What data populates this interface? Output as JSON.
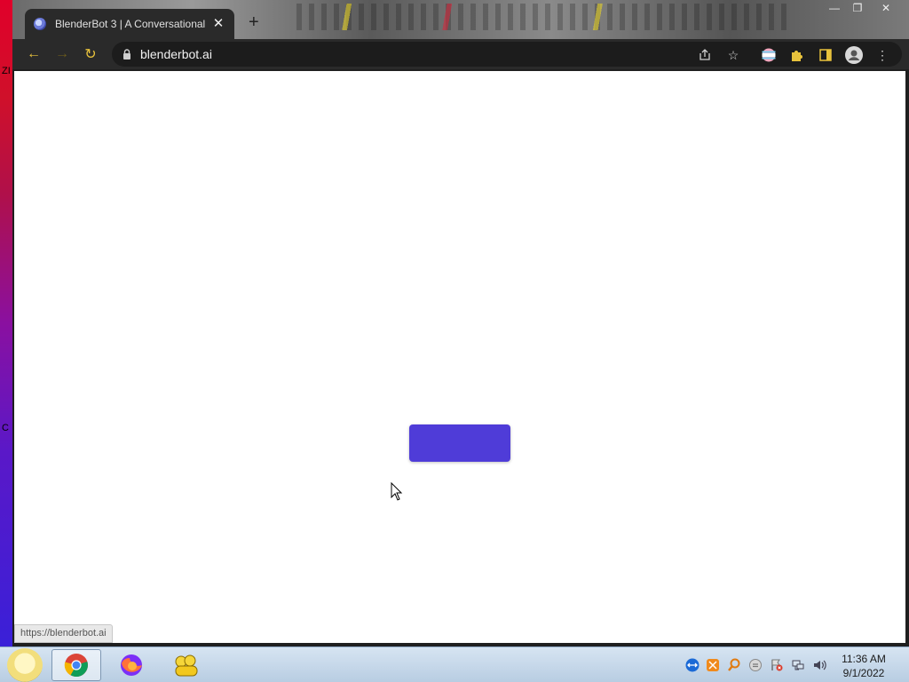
{
  "desktop": {
    "edge_label_top": "ZI",
    "edge_label_mid": "C"
  },
  "browser": {
    "tab": {
      "title": "BlenderBot 3 | A Conversational",
      "close_glyph": "✕"
    },
    "new_tab_glyph": "+",
    "window_controls": {
      "minimize": "—",
      "restore": "❐",
      "close": "✕"
    },
    "toolbar": {
      "back_glyph": "←",
      "forward_glyph": "→",
      "reload_glyph": "↻"
    },
    "omnibox": {
      "url": "blenderbot.ai"
    },
    "omnibox_icons": [
      "share-icon",
      "star-icon",
      "extension-flag-icon",
      "puzzle-icon",
      "sidepanel-icon",
      "profile-icon",
      "menu-icon"
    ],
    "status_url": "https://blenderbot.ai"
  },
  "page": {
    "cta_button": {
      "label": "",
      "color": "#4f3cd8"
    }
  },
  "taskbar": {
    "apps": [
      "start-orb",
      "chrome",
      "firefox",
      "people"
    ],
    "clock": {
      "time": "11:36 AM",
      "date": "9/1/2022"
    }
  },
  "colors": {
    "accent_yellow": "#e8c23c",
    "button_purple": "#4f3cd8",
    "browser_dark": "#2a2a2a"
  }
}
